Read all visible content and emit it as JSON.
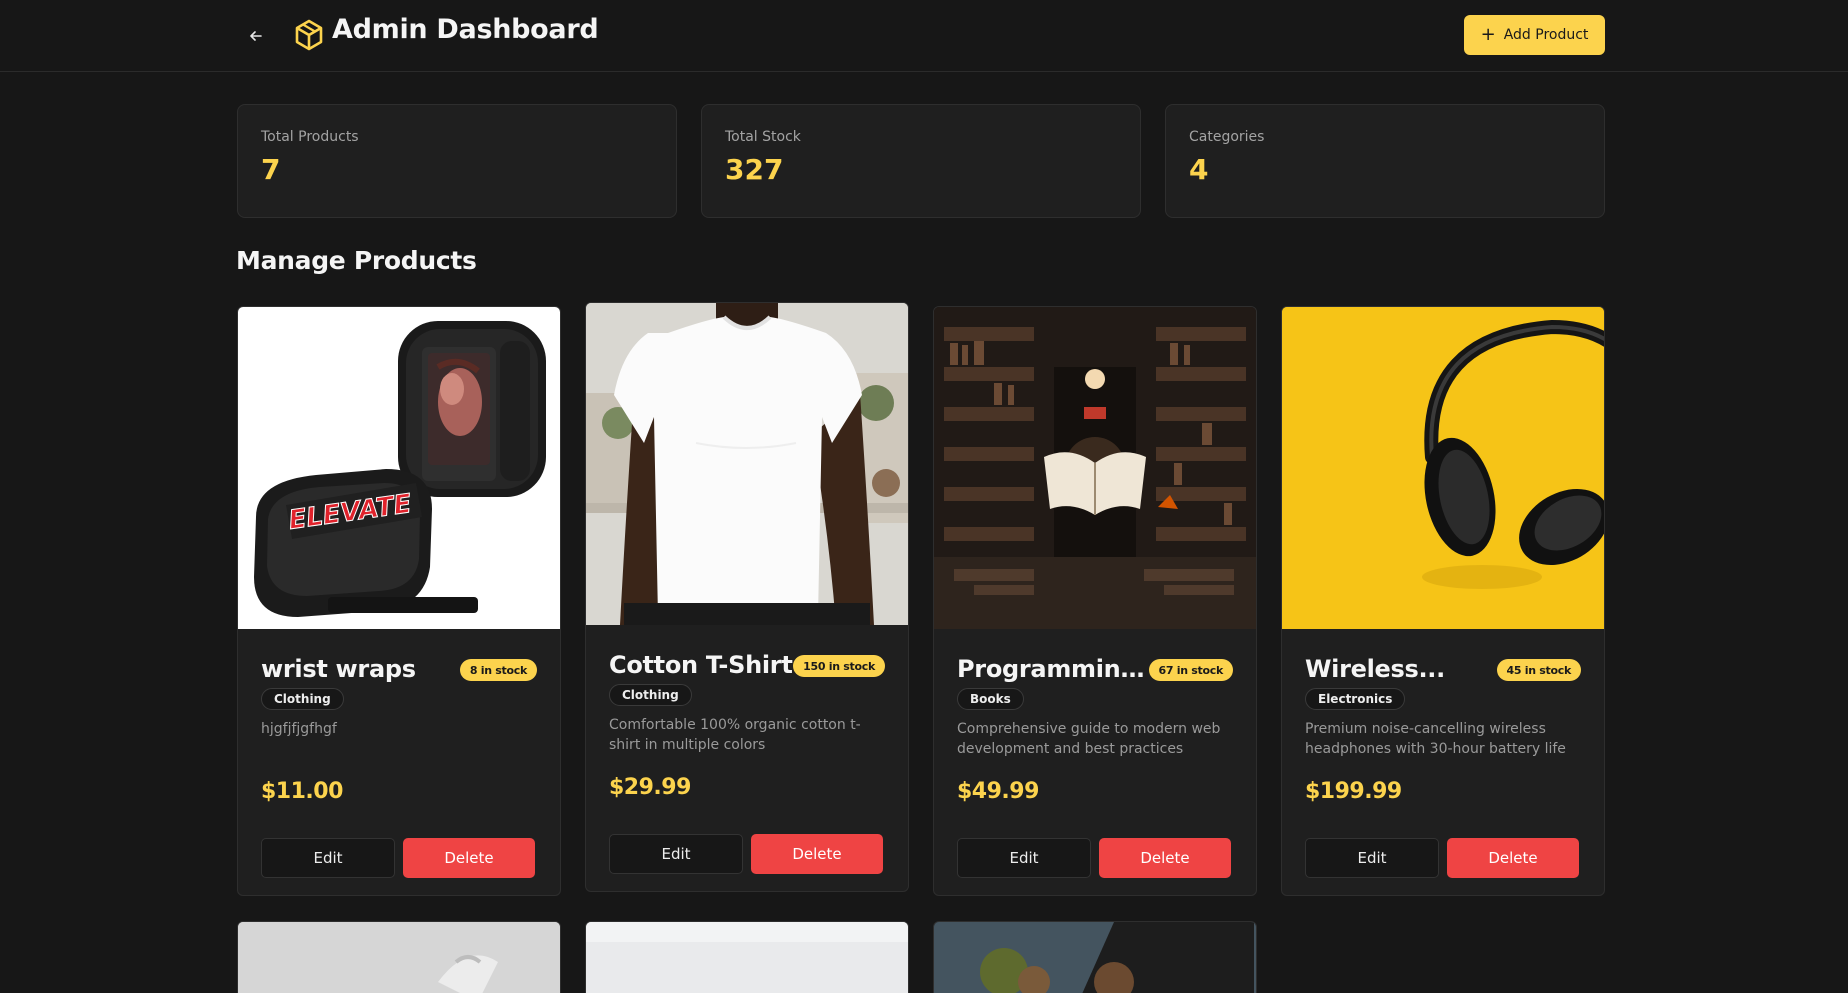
{
  "header": {
    "title": "Admin Dashboard",
    "add_button_label": "Add Product"
  },
  "stats": [
    {
      "label": "Total Products",
      "value": "7"
    },
    {
      "label": "Total Stock",
      "value": "327"
    },
    {
      "label": "Categories",
      "value": "4"
    }
  ],
  "section_title": "Manage Products",
  "products": [
    {
      "name": "wrist wraps",
      "stock": "8 in stock",
      "category": "Clothing",
      "description": "hjgfjfjgfhgf",
      "price": "$11.00",
      "edit_label": "Edit",
      "delete_label": "Delete"
    },
    {
      "name": "Cotton T-Shirt",
      "stock": "150 in stock",
      "category": "Clothing",
      "description": "Comfortable 100% organic cotton t-shirt in multiple colors",
      "price": "$29.99",
      "edit_label": "Edit",
      "delete_label": "Delete"
    },
    {
      "name": "Programming...",
      "stock": "67 in stock",
      "category": "Books",
      "description": "Comprehensive guide to modern web development and best practices",
      "price": "$49.99",
      "edit_label": "Edit",
      "delete_label": "Delete"
    },
    {
      "name": "Wireless...",
      "stock": "45 in stock",
      "category": "Electronics",
      "description": "Premium noise-cancelling wireless headphones with 30-hour battery life",
      "price": "$199.99",
      "edit_label": "Edit",
      "delete_label": "Delete"
    }
  ],
  "elevate_logo_text": "ELEVATE",
  "colors": {
    "background": "#171717",
    "card": "#1f1f1f",
    "accent": "#fcd34d",
    "danger": "#ef4444"
  }
}
